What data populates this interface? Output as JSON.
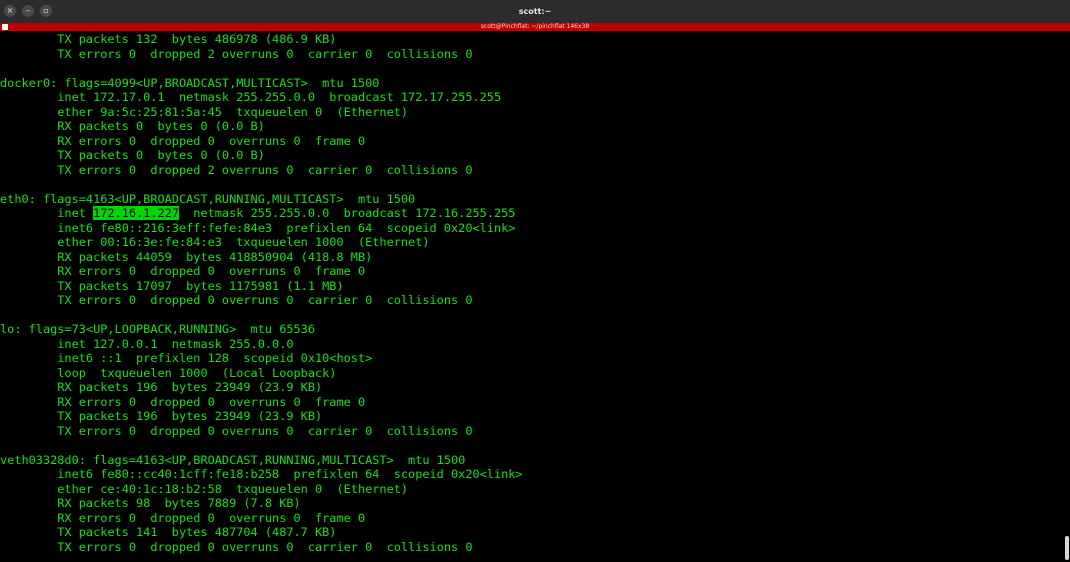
{
  "window": {
    "title": "scott:~",
    "close_icon": "×",
    "minimize_icon": "–",
    "maximize_icon": "▫"
  },
  "tab": {
    "title": "scott@Pinchflat: ~/pinchflat 146x38"
  },
  "colors": {
    "terminal_text": "#18e018",
    "terminal_bg": "#000000",
    "tab_bar": "#c00000",
    "highlight": "#00d700"
  },
  "terminal": {
    "highlighted_ip": "172.16.1.227",
    "lines": [
      "        TX packets 132  bytes 486978 (486.9 KB)",
      "        TX errors 0  dropped 2 overruns 0  carrier 0  collisions 0",
      "",
      "docker0: flags=4099<UP,BROADCAST,MULTICAST>  mtu 1500",
      "        inet 172.17.0.1  netmask 255.255.0.0  broadcast 172.17.255.255",
      "        ether 9a:5c:25:81:5a:45  txqueuelen 0  (Ethernet)",
      "        RX packets 0  bytes 0 (0.0 B)",
      "        RX errors 0  dropped 0  overruns 0  frame 0",
      "        TX packets 0  bytes 0 (0.0 B)",
      "        TX errors 0  dropped 2 overruns 0  carrier 0  collisions 0",
      "",
      "eth0: flags=4163<UP,BROADCAST,RUNNING,MULTICAST>  mtu 1500",
      "        inet 172.16.1.227  netmask 255.255.0.0  broadcast 172.16.255.255",
      "        inet6 fe80::216:3eff:fefe:84e3  prefixlen 64  scopeid 0x20<link>",
      "        ether 00:16:3e:fe:84:e3  txqueuelen 1000  (Ethernet)",
      "        RX packets 44059  bytes 418850904 (418.8 MB)",
      "        RX errors 0  dropped 0  overruns 0  frame 0",
      "        TX packets 17097  bytes 1175981 (1.1 MB)",
      "        TX errors 0  dropped 0 overruns 0  carrier 0  collisions 0",
      "",
      "lo: flags=73<UP,LOOPBACK,RUNNING>  mtu 65536",
      "        inet 127.0.0.1  netmask 255.0.0.0",
      "        inet6 ::1  prefixlen 128  scopeid 0x10<host>",
      "        loop  txqueuelen 1000  (Local Loopback)",
      "        RX packets 196  bytes 23949 (23.9 KB)",
      "        RX errors 0  dropped 0  overruns 0  frame 0",
      "        TX packets 196  bytes 23949 (23.9 KB)",
      "        TX errors 0  dropped 0 overruns 0  carrier 0  collisions 0",
      "",
      "veth03328d0: flags=4163<UP,BROADCAST,RUNNING,MULTICAST>  mtu 1500",
      "        inet6 fe80::cc40:1cff:fe18:b258  prefixlen 64  scopeid 0x20<link>",
      "        ether ce:40:1c:18:b2:58  txqueuelen 0  (Ethernet)",
      "        RX packets 98  bytes 7889 (7.8 KB)",
      "        RX errors 0  dropped 0  overruns 0  frame 0",
      "        TX packets 141  bytes 487704 (487.7 KB)",
      "        TX errors 0  dropped 0 overruns 0  carrier 0  collisions 0"
    ]
  }
}
